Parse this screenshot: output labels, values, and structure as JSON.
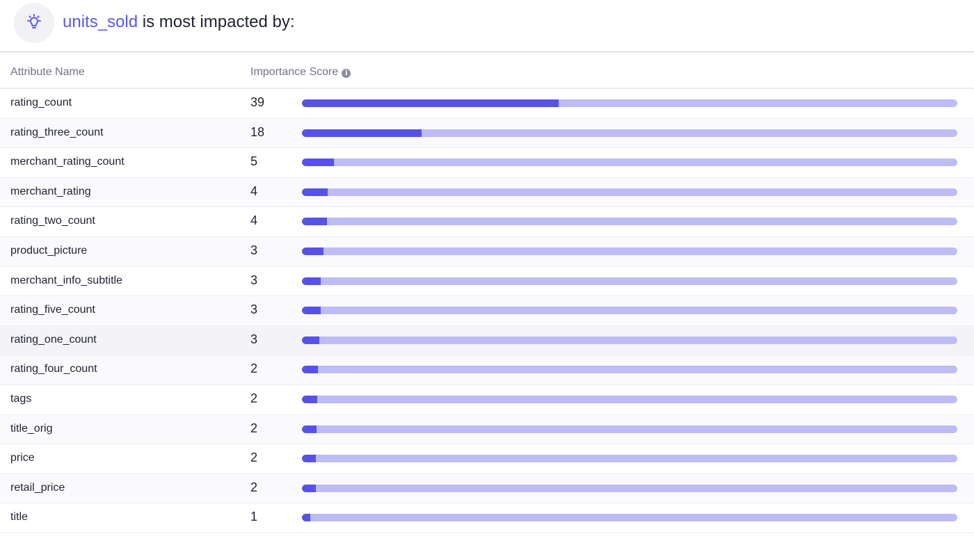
{
  "header": {
    "target": "units_sold",
    "title_rest": " is most impacted by:",
    "icon": "lightbulb-icon"
  },
  "table": {
    "columns": [
      "Attribute Name",
      "Importance Score"
    ],
    "score_max": 100,
    "rows": [
      {
        "name": "rating_count",
        "score": "39",
        "fill": 39.2
      },
      {
        "name": "rating_three_count",
        "score": "18",
        "fill": 18.3
      },
      {
        "name": "merchant_rating_count",
        "score": "5",
        "fill": 4.9
      },
      {
        "name": "merchant_rating",
        "score": "4",
        "fill": 3.9
      },
      {
        "name": "rating_two_count",
        "score": "4",
        "fill": 3.8
      },
      {
        "name": "product_picture",
        "score": "3",
        "fill": 3.3
      },
      {
        "name": "merchant_info_subtitle",
        "score": "3",
        "fill": 2.9
      },
      {
        "name": "rating_five_count",
        "score": "3",
        "fill": 2.9
      },
      {
        "name": "rating_one_count",
        "score": "3",
        "fill": 2.7
      },
      {
        "name": "rating_four_count",
        "score": "2",
        "fill": 2.4
      },
      {
        "name": "tags",
        "score": "2",
        "fill": 2.3
      },
      {
        "name": "title_orig",
        "score": "2",
        "fill": 2.2
      },
      {
        "name": "price",
        "score": "2",
        "fill": 2.1
      },
      {
        "name": "retail_price",
        "score": "2",
        "fill": 2.1
      },
      {
        "name": "title",
        "score": "1",
        "fill": 1.3
      }
    ]
  },
  "colors": {
    "accent": "#5b57e6",
    "bar_fill": "#5652e8",
    "bar_track": "#bdbcf5"
  }
}
